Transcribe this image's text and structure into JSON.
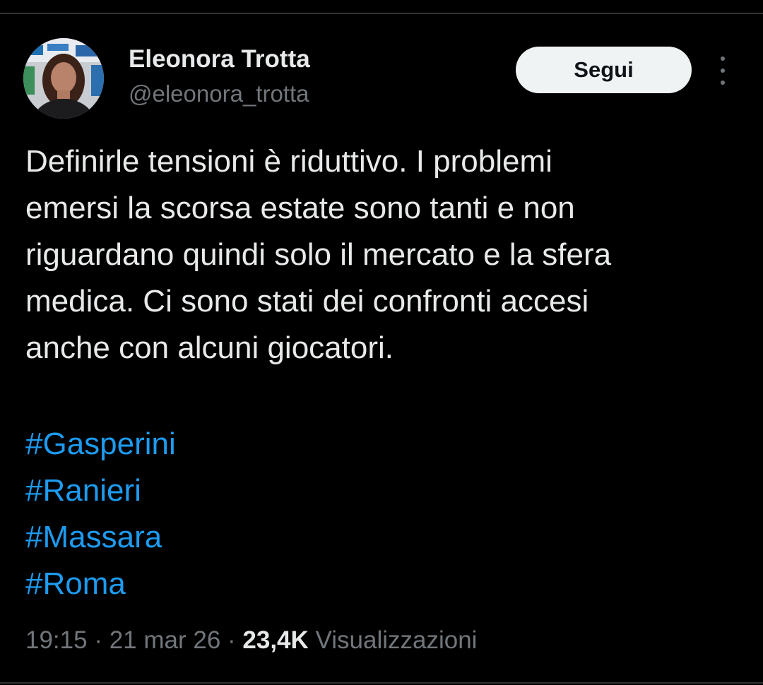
{
  "author": {
    "name": "Eleonora Trotta",
    "handle": "@eleonora_trotta"
  },
  "follow_label": "Segui",
  "tweet": {
    "text": "Definirle tensioni è riduttivo. I problemi\nemersi la scorsa estate sono tanti e non\nriguardano quindi solo il mercato e la sfera\nmedica. Ci sono stati dei confronti accesi\nanche con alcuni giocatori.",
    "hashtags": [
      "#Gasperini",
      "#Ranieri",
      "#Massara",
      "#Roma"
    ]
  },
  "meta": {
    "time": "19:15",
    "separator": " · ",
    "date": "21 mar 26",
    "views_count": "23,4K",
    "views_label": " Visualizzazioni"
  },
  "colors": {
    "background": "#000000",
    "text": "#e7e9ea",
    "secondary": "#71767b",
    "hashtag": "#1d9bf0",
    "button_bg": "#eff3f4"
  },
  "icons": {
    "more": "more-vertical-icon"
  }
}
